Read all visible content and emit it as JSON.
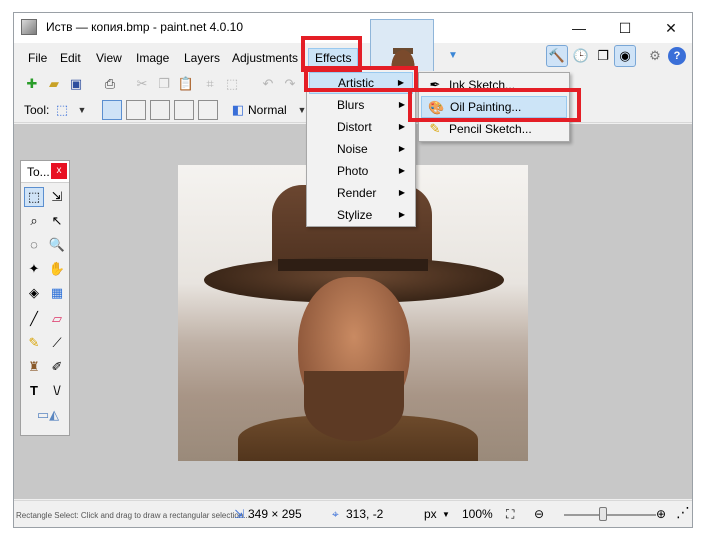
{
  "window": {
    "title": "Иств — копия.bmp - paint.net 4.0.10",
    "controls": {
      "minimize": "—",
      "maximize": "☐",
      "close": "✕"
    }
  },
  "menubar": {
    "items": [
      "File",
      "Edit",
      "View",
      "Image",
      "Layers",
      "Adjustments",
      "Effects"
    ],
    "active": "Effects"
  },
  "toolbar": {
    "tool_label": "Tool:",
    "blend_mode": "Normal"
  },
  "tools_panel": {
    "title": "To...",
    "close": "x"
  },
  "effects_menu": {
    "items": [
      {
        "label": "Artistic"
      },
      {
        "label": "Blurs"
      },
      {
        "label": "Distort"
      },
      {
        "label": "Noise"
      },
      {
        "label": "Photo"
      },
      {
        "label": "Render"
      },
      {
        "label": "Stylize"
      }
    ],
    "active": "Artistic"
  },
  "artistic_submenu": {
    "items": [
      {
        "label": "Ink Sketch...",
        "icon": "ink-sketch-icon"
      },
      {
        "label": "Oil Painting...",
        "icon": "oil-painting-icon"
      },
      {
        "label": "Pencil Sketch...",
        "icon": "pencil-sketch-icon"
      }
    ],
    "active": "Oil Painting..."
  },
  "status": {
    "hint": "Rectangle Select: Click and drag to draw a rectangular selection...",
    "image_size": "349 × 295",
    "cursor_pos": "313, -2",
    "unit": "px",
    "zoom": "100%"
  },
  "colors": {
    "highlight_red": "#e41e26",
    "menu_active": "#cce4f7",
    "canvas_bg": "#c8c8c8"
  }
}
